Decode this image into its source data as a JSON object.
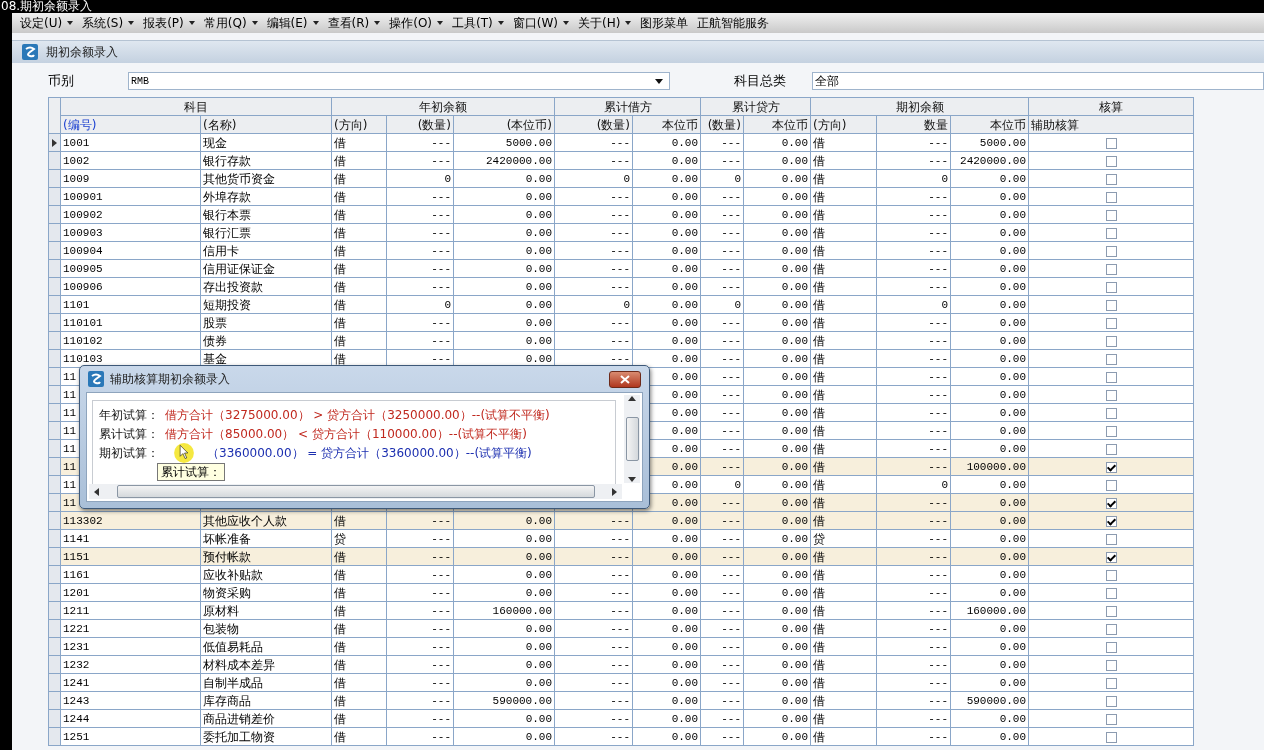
{
  "window": {
    "title": "08.期初余额录入"
  },
  "menu": [
    {
      "label": "设定(U)",
      "has_menu": true
    },
    {
      "label": "系统(S)",
      "has_menu": true
    },
    {
      "label": "报表(P)",
      "has_menu": true
    },
    {
      "label": "常用(Q)",
      "has_menu": true
    },
    {
      "label": "编辑(E)",
      "has_menu": true
    },
    {
      "label": "查看(R)",
      "has_menu": true
    },
    {
      "label": "操作(O)",
      "has_menu": true
    },
    {
      "label": "工具(T)",
      "has_menu": true
    },
    {
      "label": "窗口(W)",
      "has_menu": true
    },
    {
      "label": "关于(H)",
      "has_menu": true
    },
    {
      "label": "图形菜单",
      "has_menu": false
    },
    {
      "label": "正航智能服务",
      "has_menu": false
    }
  ],
  "form": {
    "title": "期初余额录入",
    "currency": {
      "label": "币别",
      "value": "RMB"
    },
    "category": {
      "label": "科目总类",
      "value": "全部"
    }
  },
  "table": {
    "groups": [
      {
        "label": "科目",
        "columns": [
          {
            "label": "(编号)",
            "key": true
          },
          {
            "label": "(名称)",
            "key": false
          }
        ]
      },
      {
        "label": "年初余额",
        "columns": [
          {
            "label": "(方向)",
            "key": false
          },
          {
            "label": "(数量)",
            "key": false
          },
          {
            "label": "(本位币)",
            "key": false
          }
        ]
      },
      {
        "label": "累计借方",
        "columns": [
          {
            "label": "(数量)",
            "key": false
          },
          {
            "label": "本位币",
            "key": false
          }
        ]
      },
      {
        "label": "累计贷方",
        "columns": [
          {
            "label": "(数量)",
            "key": false
          },
          {
            "label": "本位币",
            "key": false
          }
        ]
      },
      {
        "label": "期初余额",
        "columns": [
          {
            "label": "(方向)",
            "key": false
          },
          {
            "label": "数量",
            "key": false
          },
          {
            "label": "本位币",
            "key": false
          }
        ]
      },
      {
        "label": "核算",
        "columns": [
          {
            "label": "辅助核算",
            "key": false
          }
        ]
      }
    ],
    "rows": [
      {
        "selected": true,
        "auxiliary": false,
        "code": "1001",
        "name": "现金",
        "direction": "借",
        "opening_qty": "---",
        "opening_amount": "5000.00",
        "debit_qty": "---",
        "debit_amount": "0.00",
        "credit_qty": "---",
        "credit_amount": "0.00",
        "closing_direction": "借",
        "closing_qty": "---",
        "closing_amount": "5000.00"
      },
      {
        "selected": false,
        "auxiliary": false,
        "code": "1002",
        "name": "银行存款",
        "direction": "借",
        "opening_qty": "---",
        "opening_amount": "2420000.00",
        "debit_qty": "---",
        "debit_amount": "0.00",
        "credit_qty": "---",
        "credit_amount": "0.00",
        "closing_direction": "借",
        "closing_qty": "---",
        "closing_amount": "2420000.00"
      },
      {
        "selected": false,
        "auxiliary": false,
        "code": "1009",
        "name": "其他货币资金",
        "direction": "借",
        "opening_qty": "0",
        "opening_amount": "0.00",
        "debit_qty": "0",
        "debit_amount": "0.00",
        "credit_qty": "0",
        "credit_amount": "0.00",
        "closing_direction": "借",
        "closing_qty": "0",
        "closing_amount": "0.00"
      },
      {
        "selected": false,
        "auxiliary": false,
        "code": "100901",
        "name": "外埠存款",
        "direction": "借",
        "opening_qty": "---",
        "opening_amount": "0.00",
        "debit_qty": "---",
        "debit_amount": "0.00",
        "credit_qty": "---",
        "credit_amount": "0.00",
        "closing_direction": "借",
        "closing_qty": "---",
        "closing_amount": "0.00"
      },
      {
        "selected": false,
        "auxiliary": false,
        "code": "100902",
        "name": "银行本票",
        "direction": "借",
        "opening_qty": "---",
        "opening_amount": "0.00",
        "debit_qty": "---",
        "debit_amount": "0.00",
        "credit_qty": "---",
        "credit_amount": "0.00",
        "closing_direction": "借",
        "closing_qty": "---",
        "closing_amount": "0.00"
      },
      {
        "selected": false,
        "auxiliary": false,
        "code": "100903",
        "name": "银行汇票",
        "direction": "借",
        "opening_qty": "---",
        "opening_amount": "0.00",
        "debit_qty": "---",
        "debit_amount": "0.00",
        "credit_qty": "---",
        "credit_amount": "0.00",
        "closing_direction": "借",
        "closing_qty": "---",
        "closing_amount": "0.00"
      },
      {
        "selected": false,
        "auxiliary": false,
        "code": "100904",
        "name": "信用卡",
        "direction": "借",
        "opening_qty": "---",
        "opening_amount": "0.00",
        "debit_qty": "---",
        "debit_amount": "0.00",
        "credit_qty": "---",
        "credit_amount": "0.00",
        "closing_direction": "借",
        "closing_qty": "---",
        "closing_amount": "0.00"
      },
      {
        "selected": false,
        "auxiliary": false,
        "code": "100905",
        "name": "信用证保证金",
        "direction": "借",
        "opening_qty": "---",
        "opening_amount": "0.00",
        "debit_qty": "---",
        "debit_amount": "0.00",
        "credit_qty": "---",
        "credit_amount": "0.00",
        "closing_direction": "借",
        "closing_qty": "---",
        "closing_amount": "0.00"
      },
      {
        "selected": false,
        "auxiliary": false,
        "code": "100906",
        "name": "存出投资款",
        "direction": "借",
        "opening_qty": "---",
        "opening_amount": "0.00",
        "debit_qty": "---",
        "debit_amount": "0.00",
        "credit_qty": "---",
        "credit_amount": "0.00",
        "closing_direction": "借",
        "closing_qty": "---",
        "closing_amount": "0.00"
      },
      {
        "selected": false,
        "auxiliary": false,
        "code": "1101",
        "name": "短期投资",
        "direction": "借",
        "opening_qty": "0",
        "opening_amount": "0.00",
        "debit_qty": "0",
        "debit_amount": "0.00",
        "credit_qty": "0",
        "credit_amount": "0.00",
        "closing_direction": "借",
        "closing_qty": "0",
        "closing_amount": "0.00"
      },
      {
        "selected": false,
        "auxiliary": false,
        "code": "110101",
        "name": "股票",
        "direction": "借",
        "opening_qty": "---",
        "opening_amount": "0.00",
        "debit_qty": "---",
        "debit_amount": "0.00",
        "credit_qty": "---",
        "credit_amount": "0.00",
        "closing_direction": "借",
        "closing_qty": "---",
        "closing_amount": "0.00"
      },
      {
        "selected": false,
        "auxiliary": false,
        "code": "110102",
        "name": "债券",
        "direction": "借",
        "opening_qty": "---",
        "opening_amount": "0.00",
        "debit_qty": "---",
        "debit_amount": "0.00",
        "credit_qty": "---",
        "credit_amount": "0.00",
        "closing_direction": "借",
        "closing_qty": "---",
        "closing_amount": "0.00"
      },
      {
        "selected": false,
        "auxiliary": false,
        "code": "110103",
        "name": "基金",
        "direction": "借",
        "opening_qty": "---",
        "opening_amount": "0.00",
        "debit_qty": "---",
        "debit_amount": "0.00",
        "credit_qty": "---",
        "credit_amount": "0.00",
        "closing_direction": "借",
        "closing_qty": "---",
        "closing_amount": "0.00"
      },
      {
        "selected": false,
        "auxiliary": false,
        "code": "11",
        "debit_amount": "0.00",
        "credit_qty": "---",
        "credit_amount": "0.00",
        "closing_direction": "借",
        "closing_qty": "---",
        "closing_amount": "0.00"
      },
      {
        "selected": false,
        "auxiliary": false,
        "code": "11",
        "debit_amount": "0.00",
        "credit_qty": "---",
        "credit_amount": "0.00",
        "closing_direction": "借",
        "closing_qty": "---",
        "closing_amount": "0.00"
      },
      {
        "selected": false,
        "auxiliary": false,
        "code": "11",
        "debit_amount": "0.00",
        "credit_qty": "---",
        "credit_amount": "0.00",
        "closing_direction": "借",
        "closing_qty": "---",
        "closing_amount": "0.00"
      },
      {
        "selected": false,
        "auxiliary": false,
        "code": "11",
        "debit_amount": "0.00",
        "credit_qty": "---",
        "credit_amount": "0.00",
        "closing_direction": "借",
        "closing_qty": "---",
        "closing_amount": "0.00"
      },
      {
        "selected": false,
        "auxiliary": false,
        "code": "11",
        "debit_amount": "0.00",
        "credit_qty": "---",
        "credit_amount": "0.00",
        "closing_direction": "借",
        "closing_qty": "---",
        "closing_amount": "0.00"
      },
      {
        "selected": false,
        "auxiliary": true,
        "code": "11",
        "debit_amount": "0.00",
        "credit_qty": "---",
        "credit_amount": "0.00",
        "closing_direction": "借",
        "closing_qty": "---",
        "closing_amount": "100000.00"
      },
      {
        "selected": false,
        "auxiliary": false,
        "code": "11",
        "debit_amount": "0.00",
        "credit_qty": "0",
        "credit_amount": "0.00",
        "closing_direction": "借",
        "closing_qty": "0",
        "closing_amount": "0.00"
      },
      {
        "selected": false,
        "auxiliary": true,
        "code": "11",
        "debit_amount": "0.00",
        "credit_qty": "---",
        "credit_amount": "0.00",
        "closing_direction": "借",
        "closing_qty": "---",
        "closing_amount": "0.00"
      },
      {
        "selected": false,
        "auxiliary": true,
        "code": "113302",
        "name": "其他应收个人款",
        "direction": "借",
        "opening_qty": "---",
        "opening_amount": "0.00",
        "debit_qty": "---",
        "debit_amount": "0.00",
        "credit_qty": "---",
        "credit_amount": "0.00",
        "closing_direction": "借",
        "closing_qty": "---",
        "closing_amount": "0.00"
      },
      {
        "selected": false,
        "auxiliary": false,
        "code": "1141",
        "name": "坏帐准备",
        "direction": "贷",
        "opening_qty": "---",
        "opening_amount": "0.00",
        "debit_qty": "---",
        "debit_amount": "0.00",
        "credit_qty": "---",
        "credit_amount": "0.00",
        "closing_direction": "贷",
        "closing_qty": "---",
        "closing_amount": "0.00"
      },
      {
        "selected": false,
        "auxiliary": true,
        "code": "1151",
        "name": "预付帐款",
        "direction": "借",
        "opening_qty": "---",
        "opening_amount": "0.00",
        "debit_qty": "---",
        "debit_amount": "0.00",
        "credit_qty": "---",
        "credit_amount": "0.00",
        "closing_direction": "借",
        "closing_qty": "---",
        "closing_amount": "0.00"
      },
      {
        "selected": false,
        "auxiliary": false,
        "code": "1161",
        "name": "应收补贴款",
        "direction": "借",
        "opening_qty": "---",
        "opening_amount": "0.00",
        "debit_qty": "---",
        "debit_amount": "0.00",
        "credit_qty": "---",
        "credit_amount": "0.00",
        "closing_direction": "借",
        "closing_qty": "---",
        "closing_amount": "0.00"
      },
      {
        "selected": false,
        "auxiliary": false,
        "code": "1201",
        "name": "物资采购",
        "direction": "借",
        "opening_qty": "---",
        "opening_amount": "0.00",
        "debit_qty": "---",
        "debit_amount": "0.00",
        "credit_qty": "---",
        "credit_amount": "0.00",
        "closing_direction": "借",
        "closing_qty": "---",
        "closing_amount": "0.00"
      },
      {
        "selected": false,
        "auxiliary": false,
        "code": "1211",
        "name": "原材料",
        "direction": "借",
        "opening_qty": "---",
        "opening_amount": "160000.00",
        "debit_qty": "---",
        "debit_amount": "0.00",
        "credit_qty": "---",
        "credit_amount": "0.00",
        "closing_direction": "借",
        "closing_qty": "---",
        "closing_amount": "160000.00"
      },
      {
        "selected": false,
        "auxiliary": false,
        "code": "1221",
        "name": "包装物",
        "direction": "借",
        "opening_qty": "---",
        "opening_amount": "0.00",
        "debit_qty": "---",
        "debit_amount": "0.00",
        "credit_qty": "---",
        "credit_amount": "0.00",
        "closing_direction": "借",
        "closing_qty": "---",
        "closing_amount": "0.00"
      },
      {
        "selected": false,
        "auxiliary": false,
        "code": "1231",
        "name": "低值易耗品",
        "direction": "借",
        "opening_qty": "---",
        "opening_amount": "0.00",
        "debit_qty": "---",
        "debit_amount": "0.00",
        "credit_qty": "---",
        "credit_amount": "0.00",
        "closing_direction": "借",
        "closing_qty": "---",
        "closing_amount": "0.00"
      },
      {
        "selected": false,
        "auxiliary": false,
        "code": "1232",
        "name": "材料成本差异",
        "direction": "借",
        "opening_qty": "---",
        "opening_amount": "0.00",
        "debit_qty": "---",
        "debit_amount": "0.00",
        "credit_qty": "---",
        "credit_amount": "0.00",
        "closing_direction": "借",
        "closing_qty": "---",
        "closing_amount": "0.00"
      },
      {
        "selected": false,
        "auxiliary": false,
        "code": "1241",
        "name": "自制半成品",
        "direction": "借",
        "opening_qty": "---",
        "opening_amount": "0.00",
        "debit_qty": "---",
        "debit_amount": "0.00",
        "credit_qty": "---",
        "credit_amount": "0.00",
        "closing_direction": "借",
        "closing_qty": "---",
        "closing_amount": "0.00"
      },
      {
        "selected": false,
        "auxiliary": false,
        "code": "1243",
        "name": "库存商品",
        "direction": "借",
        "opening_qty": "---",
        "opening_amount": "590000.00",
        "debit_qty": "---",
        "debit_amount": "0.00",
        "credit_qty": "---",
        "credit_amount": "0.00",
        "closing_direction": "借",
        "closing_qty": "---",
        "closing_amount": "590000.00"
      },
      {
        "selected": false,
        "auxiliary": false,
        "code": "1244",
        "name": "商品进销差价",
        "direction": "借",
        "opening_qty": "---",
        "opening_amount": "0.00",
        "debit_qty": "---",
        "debit_amount": "0.00",
        "credit_qty": "---",
        "credit_amount": "0.00",
        "closing_direction": "借",
        "closing_qty": "---",
        "closing_amount": "0.00"
      },
      {
        "selected": false,
        "auxiliary": false,
        "code": "1251",
        "name": "委托加工物资",
        "direction": "借",
        "opening_qty": "---",
        "opening_amount": "0.00",
        "debit_qty": "---",
        "debit_amount": "0.00",
        "credit_qty": "---",
        "credit_amount": "0.00",
        "closing_direction": "借",
        "closing_qty": "---",
        "closing_amount": "0.00"
      }
    ]
  },
  "dialog": {
    "title": "辅助核算期初余额录入",
    "lines": [
      {
        "label": "年初试算：",
        "text": "借方合计（3275000.00） > 贷方合计（3250000.00）--(试算不平衡)",
        "balanced": false
      },
      {
        "label": "累计试算：",
        "text": "借方合计（85000.00） < 贷方合计（110000.00）--(试算不平衡)",
        "balanced": false
      },
      {
        "label": "期初试算：",
        "text": "（3360000.00） = 贷方合计（3360000.00）--(试算平衡)",
        "balanced": true
      }
    ],
    "tooltip": "累计试算："
  }
}
